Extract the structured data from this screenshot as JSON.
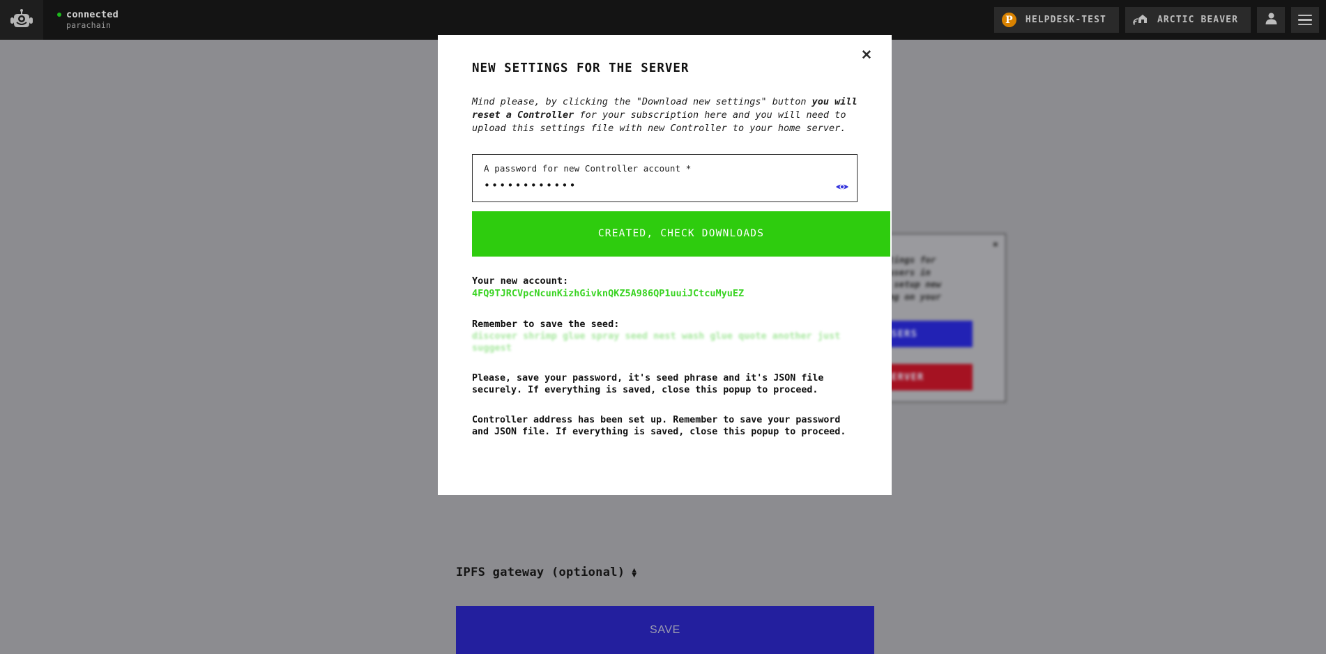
{
  "topbar": {
    "logo_icon": "robot-head-icon",
    "status": {
      "state": "connected",
      "network": "parachain"
    },
    "chips": [
      {
        "icon": "p-badge-icon",
        "label": "HELPDESK-TEST"
      },
      {
        "icon": "home-wifi-icon",
        "label": "ARCTIC BEAVER"
      }
    ],
    "account_icon": "person-icon",
    "menu_icon": "hamburger-icon"
  },
  "background": {
    "card": {
      "close_icon": "close-icon",
      "text": "p settings for\nwith users in\non or setup new\nloading on your",
      "buttons": [
        {
          "label": "R USERS",
          "color": "#2222b4"
        },
        {
          "label": "HE SERVER",
          "color": "#a51222"
        }
      ]
    },
    "ipfs": {
      "label": "IPFS gateway (optional)",
      "chevron_icon": "chevron-up-down-icon"
    },
    "save_label": "SAVE"
  },
  "modal": {
    "close_icon": "close-icon",
    "title": "NEW SETTINGS FOR THE SERVER",
    "intro": {
      "part1": "Mind please, by clicking the \"Download new settings\" button ",
      "bold1": "you will reset a Controller",
      "part2": " for your subscription here and you will need to upload this settings file with new Controller to your home server."
    },
    "password_field": {
      "label": "A password for new Controller account *",
      "value": "••••••••••••",
      "reveal_icon": "eye-icon",
      "reveal_icon_color": "#3333dd"
    },
    "created_button": {
      "label": "CREATED, CHECK DOWNLOADS",
      "color": "#2ecc0e"
    },
    "account_heading": "Your new account:",
    "account_address": "4FQ9TJRCVpcNcunKizhGivknQKZ5A986QP1uuiJCtcuMyuEZ",
    "seed_heading": "Remember to save the seed:",
    "seed_phrase": "discover shrimp glue spray seed nest wash glue quote another just suggest",
    "note1": "Please, save your password, it's seed phrase and it's JSON file securely. If everything is saved, close this popup to proceed.",
    "note2": "Controller address has been set up. Remember to save your password and JSON file. If everything is saved, close this popup to proceed."
  },
  "colors": {
    "topbar_bg": "#141414",
    "overlay_bg": "#8c8c90",
    "accent_green": "#2ecc0e",
    "accent_indigo": "#231f9e",
    "address_green": "#3ad423",
    "orange_badge": "#d98200"
  }
}
